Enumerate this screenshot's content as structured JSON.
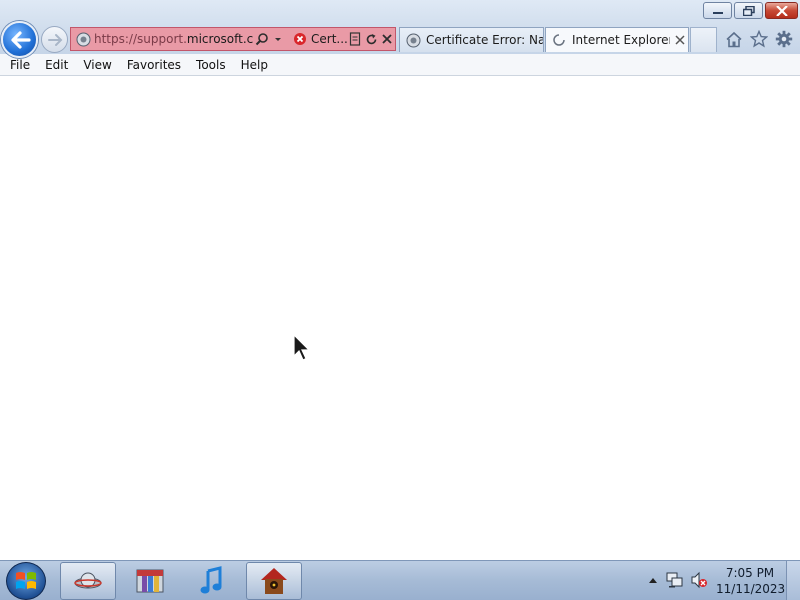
{
  "window": {
    "controls": [
      "minimize",
      "restore",
      "close"
    ]
  },
  "address_bar": {
    "url_scheme": "https://support.",
    "url_host": "microsoft.c...",
    "cert_label": "Cert...",
    "bg_color": "#e99aa6"
  },
  "tabs": [
    {
      "title": "Certificate Error: Na...",
      "icon": "ie-page-icon",
      "active": false
    },
    {
      "title": "Internet Explorer ...",
      "icon": "loading-spinner-icon",
      "active": true
    }
  ],
  "toolbar_icons": [
    "home-icon",
    "favorites-star-icon",
    "settings-gear-icon"
  ],
  "menu": {
    "items": [
      "File",
      "Edit",
      "View",
      "Favorites",
      "Tools",
      "Help"
    ]
  },
  "taskbar": {
    "pinned": [
      "start-orb",
      "browser-app",
      "archive-app",
      "music-app",
      "birdhouse-app"
    ],
    "clock": {
      "time": "7:05 PM",
      "date": "11/11/2023"
    },
    "tray_icons": [
      "show-hidden-icons",
      "network-icon",
      "volume-muted-icon"
    ]
  },
  "colors": {
    "accent": "#1f6fd6",
    "cert_error_red": "#d9262b"
  }
}
